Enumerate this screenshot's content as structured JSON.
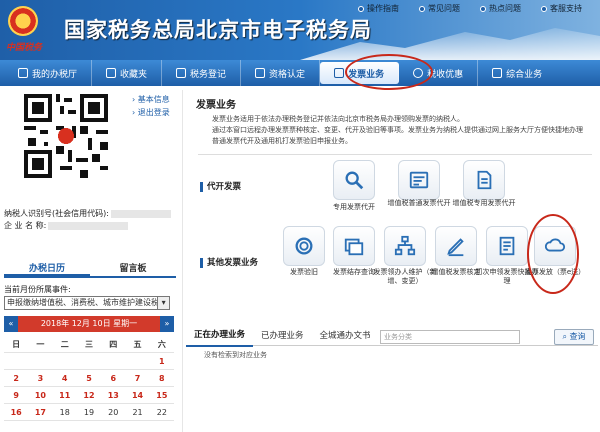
{
  "header": {
    "logo_text": "中国税务",
    "title": "国家税务总局北京市电子税务局",
    "toplinks": [
      "操作指南",
      "常见问题",
      "热点问题",
      "客服支持"
    ]
  },
  "nav": [
    {
      "label": "我的办税厅",
      "icon": "home-icon"
    },
    {
      "label": "收藏夹",
      "icon": "folder-icon"
    },
    {
      "label": "税务登记",
      "icon": "flag-icon"
    },
    {
      "label": "资格认定",
      "icon": "certificate-icon"
    },
    {
      "label": "发票业务",
      "icon": "invoice-icon",
      "active": true
    },
    {
      "label": "税收优惠",
      "icon": "discount-icon"
    },
    {
      "label": "综合业务",
      "icon": "grid-icon"
    }
  ],
  "left": {
    "side_links": [
      "基本信息",
      "退出登录"
    ],
    "taxpayer_id_label": "纳税人识别号(社会信用代码):",
    "company_label": "企 业 名 称:",
    "tabs": [
      "办税日历",
      "留言板"
    ],
    "event_label": "当前月份所属事件:",
    "event_select": "申报缴纳增值税、消费税、城市维护建设税",
    "calendar": {
      "header": "2018年 12月 10日 星期一",
      "prev": "«",
      "next": "»",
      "weekdays": [
        "日",
        "一",
        "二",
        "三",
        "四",
        "五",
        "六"
      ],
      "rows": [
        [
          "",
          "",
          "",
          "",
          "",
          "",
          "1"
        ],
        [
          "2",
          "3",
          "4",
          "5",
          "6",
          "7",
          "8"
        ],
        [
          "9",
          "10",
          "11",
          "12",
          "13",
          "14",
          "15"
        ],
        [
          "16",
          "17",
          "18",
          "19",
          "20",
          "21",
          "22"
        ]
      ],
      "red_days": [
        "1",
        "2",
        "3",
        "4",
        "5",
        "6",
        "7",
        "8",
        "9",
        "10",
        "11",
        "12",
        "13",
        "14",
        "15",
        "16",
        "17"
      ]
    }
  },
  "main": {
    "title": "发票业务",
    "desc": [
      "发票业务适用于依法办理税务登记并依法向北京市税务局办理领购发票的纳税人。",
      "通过本窗口远程办理发票票种核定、变更、代开及验旧等事项。发票业务为纳税人提供通过网上服务大厅方便快捷地办理普通发票代开及通用机打发票验旧申报业务。"
    ],
    "groups": [
      {
        "label": "代开发票",
        "items": [
          {
            "label": "专用发票代开",
            "icon": "search-icon"
          },
          {
            "label": "增值税普通发票代开",
            "icon": "invoice-doc-icon"
          },
          {
            "label": "增值税专用发票代开",
            "icon": "document-icon"
          }
        ]
      },
      {
        "label": "其他发票业务",
        "items": [
          {
            "label": "发票验旧",
            "icon": "ring-icon"
          },
          {
            "label": "发票结存查询",
            "icon": "stack-icon"
          },
          {
            "label": "发票领办人维护（新增、变更）",
            "icon": "network-icon"
          },
          {
            "label": "增值税发票核定",
            "icon": "pen-icon"
          },
          {
            "label": "初次申领发票快捷办理",
            "icon": "form-icon"
          },
          {
            "label": "发票发放（票e送）",
            "icon": "cloud-icon"
          }
        ]
      }
    ]
  },
  "biz": {
    "tabs": [
      "正在办理业务",
      "已办理业务",
      "全城通办文书"
    ],
    "search_placeholder": "业务分类",
    "query_button": "查询",
    "empty": "没有检索到对应业务"
  }
}
